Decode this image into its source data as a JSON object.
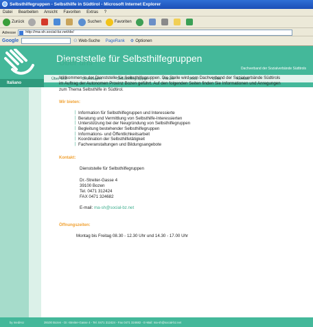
{
  "window": {
    "title": "Selbsthilfegruppen - Selbsthilfe in Südtirol - Microsoft Internet Explorer"
  },
  "menu": [
    "Datei",
    "Bearbeiten",
    "Ansicht",
    "Favoriten",
    "Extras",
    "?"
  ],
  "toolbar": {
    "back": "Zurück",
    "search": "Suchen",
    "favorites": "Favoriten"
  },
  "address": {
    "label": "Adresse",
    "url": "http://ma-sh.social-bz.net/de/"
  },
  "google": {
    "logo": "Google",
    "websearch": "Web-Suche",
    "pagerank": "PageRank",
    "options": "Optionen"
  },
  "site": {
    "title": "Dienststelle für Selbsthilfegruppen",
    "subtitle": "Dachverband der Sozialverbände Südtirols",
    "language": "Italiano",
    "nav": [
      "Über uns",
      "Grundlagen",
      "Selbsthilfegruppen",
      "Forum",
      "Infos",
      "Links",
      "Kontakt"
    ],
    "heading": "Über uns",
    "intro": "Willkommen in der Dienststelle für Selbsthilfegruppen. Die Stelle wird vom Dachverband der Sozialverbände Südtirols im Auftrag der Autonomen Provinz Bozen geführt. Auf den folgenden Seiten finden Sie Informationen und Anregungen zum Thema Selbsthilfe in Südtirol.",
    "offer_heading": "Wir bieten:",
    "offers": [
      "Information für Selbsthilfegruppen und Interessierte",
      "Beratung und Vermittlung von Selbsthilfe-Interessierten",
      "Unterstützung bei der Neugründung von Selbsthilfegruppen",
      "Begleitung bestehender Selbsthilfegruppen",
      "Informations- und Öffentlichkeitsarbeit",
      "Koordination der Selbsthilfetätigkeit",
      "Fachveranstaltungen und Bildungsangebote"
    ],
    "contact_heading": "Kontakt:",
    "contact_org": "Dienststelle für Selbsthilfegruppen",
    "contact_street": "Dr.-Streiter-Gasse 4",
    "contact_city": "39100 Bozen",
    "contact_tel": "Tel. 0471 312424",
    "contact_fax": "FAX 0471 324682",
    "contact_email_label": "E-mail:",
    "contact_email": "ma-sh@social-bz.net",
    "hours_heading": "Öffnungszeiten:",
    "hours": "Montag bis Freitag 08.30 - 12.30 Uhr und 14.30 - 17.00 Uhr",
    "footer_left": "by mediAU",
    "footer": "39100 Bozen - Dr.-Streiter-Gasse 4 - Tel. 0471 312424 - Fax 0471 324682 - E-Mail: ma-sh@social-bz.net"
  }
}
